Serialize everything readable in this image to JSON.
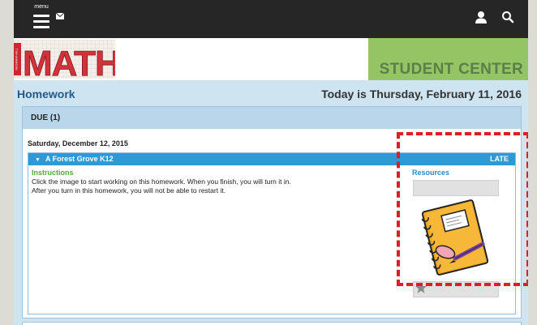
{
  "header": {
    "menu_caption": "menu",
    "icons": [
      "hamburger-icon",
      "mail-icon",
      "user-icon",
      "search-icon"
    ]
  },
  "banner": {
    "logo_text": "MATH",
    "logo_side_text": "McGRAW-HILL",
    "student_center": "STUDENT CENTER"
  },
  "page": {
    "title": "Homework",
    "today": "Today is Thursday, February 11, 2016"
  },
  "due": {
    "label": "DUE (1)",
    "date": "Saturday, December 12, 2015",
    "item": {
      "name": "A Forest Grove K12",
      "status": "LATE",
      "instructions_label": "Instructions",
      "instructions_text": "Click the image to start working on this homework. When you finish, you will turn it in. After you turn in this homework, you will not be able to restart it.",
      "resources_label": "Resources"
    }
  },
  "colors": {
    "topbar": "#262626",
    "student_center_bg": "#94c464",
    "item_bar": "#2d9ad6",
    "late": "#ffffff",
    "highlight": "#e01c24",
    "title": "#275a86"
  }
}
